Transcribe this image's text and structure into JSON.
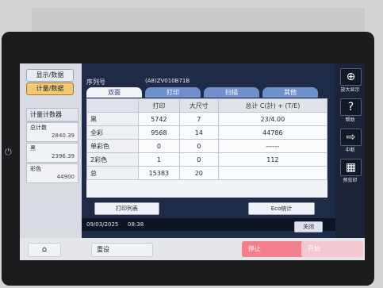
{
  "left": {
    "btn_a": "显示/数据",
    "btn_b": "计量/数据",
    "box_title": "计量计数器",
    "box_rows": [
      {
        "label": "总计数",
        "value": "2840.39"
      },
      {
        "label": "黑",
        "value": "2396.39"
      },
      {
        "label": "彩色",
        "value": "44900"
      }
    ]
  },
  "main": {
    "serial_label": "序列号",
    "serial_value": "(A8)ZV010B71B",
    "tabs": [
      "双面",
      "打印",
      "扫描",
      "其他"
    ],
    "headers": [
      "",
      "打印",
      "大尺寸",
      "总计 C(計) + (T/E)"
    ],
    "rows": [
      [
        "黑",
        "5742",
        "7",
        "23/4.00"
      ],
      [
        "全彩",
        "9568",
        "14",
        "44786"
      ],
      [
        "单彩色",
        "0",
        "0",
        "------"
      ],
      [
        "2彩色",
        "1",
        "0",
        "112"
      ],
      [
        "总",
        "15383",
        "20",
        ""
      ]
    ],
    "btn_list": "打印列表",
    "btn_eco": "Eco统计",
    "date": "09/03/2025",
    "time": "08:38",
    "btn_close": "关闭"
  },
  "right": [
    {
      "icon": "zoom-icon",
      "glyph": "⊕",
      "label": "放大显示"
    },
    {
      "icon": "help-icon",
      "glyph": "?",
      "label": "帮助"
    },
    {
      "icon": "interrupt-icon",
      "glyph": "⇨",
      "label": "中断"
    },
    {
      "icon": "preview-icon",
      "glyph": "▦",
      "label": "预览印"
    }
  ],
  "bottom": {
    "reset": "重设",
    "stop": "停止",
    "start": "开始"
  }
}
